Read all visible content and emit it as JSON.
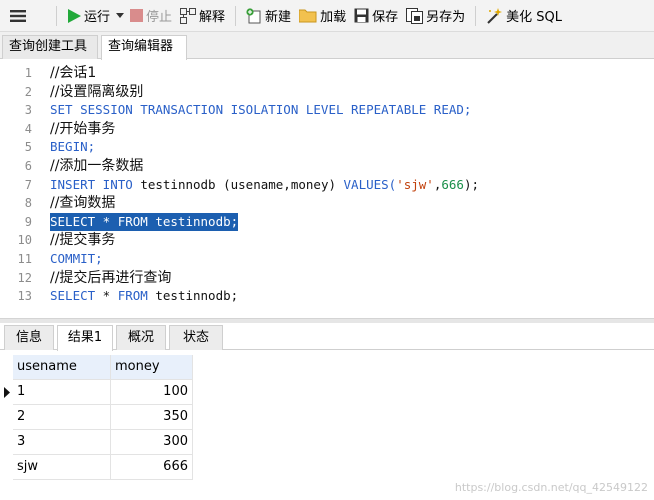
{
  "toolbar": {
    "run_label": "运行",
    "stop_label": "停止",
    "explain_label": "解释",
    "new_label": "新建",
    "load_label": "加载",
    "save_label": "保存",
    "saveas_label": "另存为",
    "beautify_label": "美化 SQL"
  },
  "editor_tabs": [
    {
      "label": "查询创建工具"
    },
    {
      "label": "查询编辑器"
    }
  ],
  "editor": {
    "line_numbers": [
      "1",
      "2",
      "3",
      "4",
      "5",
      "6",
      "7",
      "8",
      "9",
      "10",
      "11",
      "12",
      "13"
    ],
    "l1": "//会话1",
    "l2": "//设置隔离级别",
    "l3": "SET SESSION TRANSACTION ISOLATION LEVEL REPEATABLE READ;",
    "l4": "//开始事务",
    "l5": "BEGIN;",
    "l6": "//添加一条数据",
    "l7_kw1": "INSERT INTO",
    "l7_plain": " testinnodb (usename,money) ",
    "l7_kw2": "VALUES(",
    "l7_str": "'sjw'",
    "l7_comma": ",",
    "l7_num": "666",
    "l7_end": ");",
    "l8": "//查询数据",
    "l9": "SELECT * FROM testinnodb;",
    "l10": "//提交事务",
    "l11": "COMMIT;",
    "l12": "//提交后再进行查询",
    "l13_kw1": "SELECT",
    "l13_star": " * ",
    "l13_kw2": "FROM",
    "l13_plain": " testinnodb;"
  },
  "result_tabs": [
    {
      "label": "信息"
    },
    {
      "label": "结果1"
    },
    {
      "label": "概况"
    },
    {
      "label": "状态"
    }
  ],
  "grid": {
    "columns": [
      "usename",
      "money"
    ],
    "rows": [
      [
        "1",
        "100"
      ],
      [
        "2",
        "350"
      ],
      [
        "3",
        "300"
      ],
      [
        "sjw",
        "666"
      ]
    ]
  },
  "watermark": "https://blog.csdn.net/qq_42549122",
  "colors": {
    "keyword": "#2a60c8",
    "string": "#c2410c",
    "number": "#1a8f4a",
    "selection": "#1c5fb0",
    "run_icon": "#22a93a",
    "stop_icon": "#d98c8c"
  },
  "icons": [
    "menu-icon",
    "run-icon",
    "dropdown-arrow-icon",
    "stop-icon",
    "explain-icon",
    "new-query-icon",
    "load-folder-icon",
    "save-icon",
    "save-as-icon",
    "beautify-wand-icon",
    "current-row-icon"
  ]
}
